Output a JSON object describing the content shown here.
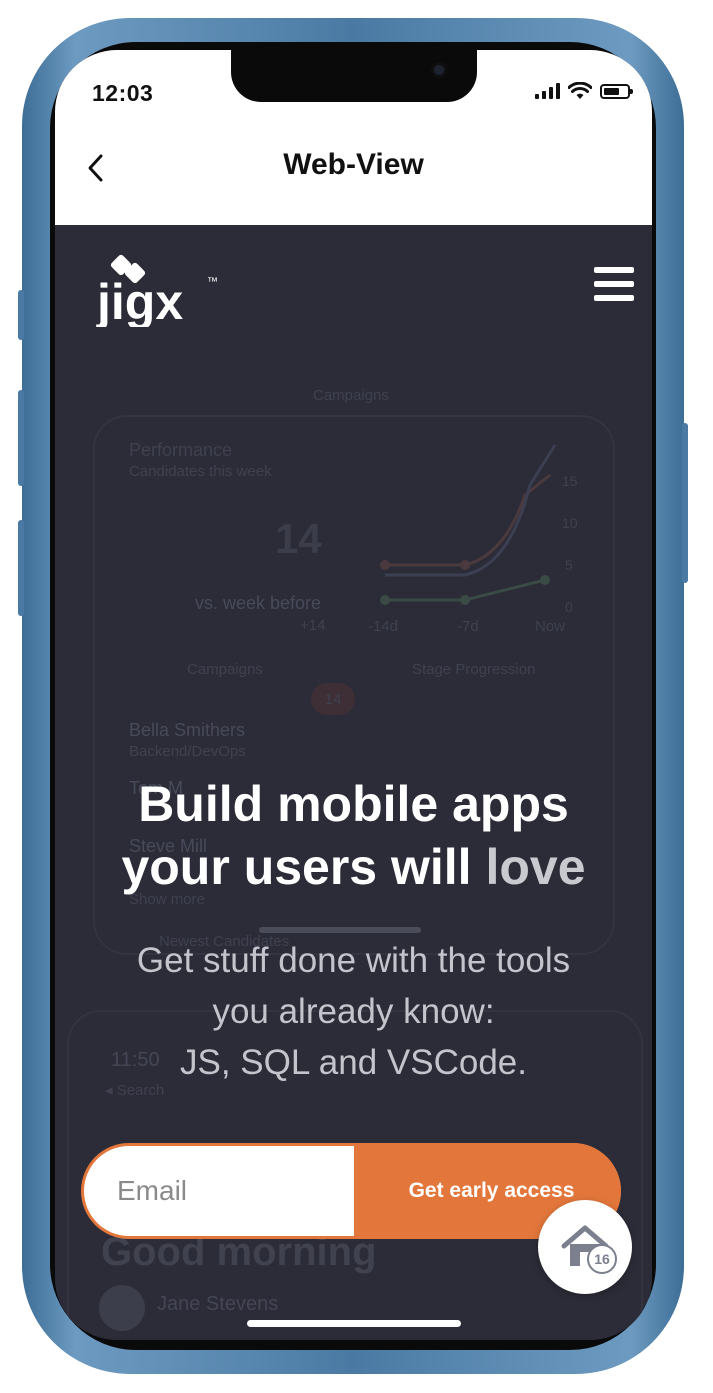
{
  "status_bar": {
    "time": "12:03"
  },
  "nav": {
    "title": "Web-View",
    "back_icon": "chevron-left-icon"
  },
  "site": {
    "logo_text": "jigx",
    "logo_tm": "™",
    "menu_icon": "hamburger-menu-icon"
  },
  "background_preview": {
    "campaigns_top": "Campaigns",
    "performance_title": "Performance",
    "performance_sub": "Candidates this week",
    "big_number": "14",
    "vs_label": "vs. week before",
    "delta": "+14",
    "y_ticks": [
      "15",
      "10",
      "5",
      "0"
    ],
    "x_ticks": [
      "-14d",
      "-7d",
      "Now"
    ],
    "tab_campaigns": "Campaigns",
    "tab_stage": "Stage Progression",
    "badge_count": "14",
    "person1_name": "Bella Smithers",
    "person1_role": "Backend/DevOps",
    "person2_name": "Tom M",
    "person3_name": "Steve Mill",
    "show_more": "Show more",
    "newest": "Newest Candidates",
    "phone2_time": "11:50",
    "phone2_search": "◂ Search",
    "greeting": "Good morning",
    "user_name": "Jane Stevens"
  },
  "hero": {
    "headline_line1": "Build mobile apps",
    "headline_line2_main": "your users will ",
    "headline_line2_accent": "love",
    "sub_line1": "Get stuff done with the tools",
    "sub_line2": "you already know:",
    "sub_line3": "JS, SQL and VSCode."
  },
  "signup": {
    "email_placeholder": "Email",
    "cta_label": "Get early access"
  },
  "floating_button": {
    "icon": "home-icon",
    "badge": "16"
  },
  "colors": {
    "accent": "#e3773b",
    "background": "#2b2c37",
    "frame": "#4a7aa3"
  }
}
